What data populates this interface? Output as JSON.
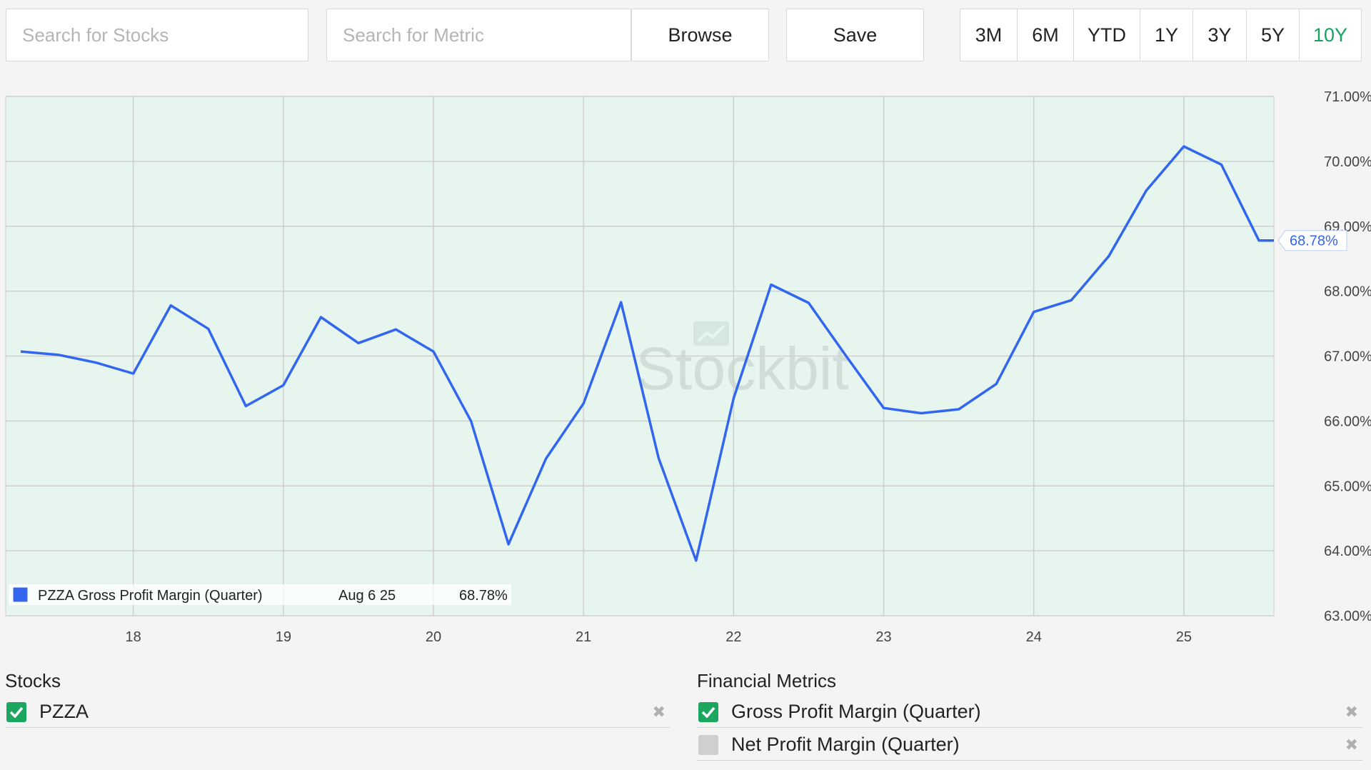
{
  "search": {
    "stocks_placeholder": "Search for Stocks",
    "metric_placeholder": "Search for Metric"
  },
  "toolbar": {
    "browse_label": "Browse",
    "save_label": "Save"
  },
  "ranges": [
    "3M",
    "6M",
    "YTD",
    "1Y",
    "3Y",
    "5Y",
    "10Y"
  ],
  "active_range": "10Y",
  "colors": {
    "series": "#3366ee",
    "plot_bg": "#e6f6ef",
    "active_range": "#16a35f",
    "checkbox_checked": "#1ca760",
    "checkbox_unchecked": "#cfcfcf"
  },
  "watermark": "Stockbit",
  "chart_data": {
    "type": "line",
    "title": "",
    "xlabel": "",
    "ylabel": "",
    "x_ticks": [
      "18",
      "19",
      "20",
      "21",
      "22",
      "23",
      "24",
      "25"
    ],
    "y_ticks": [
      "71.00%",
      "70.00%",
      "69.00%",
      "68.00%",
      "67.00%",
      "66.00%",
      "65.00%",
      "64.00%",
      "63.00%"
    ],
    "xlim": [
      2017.15,
      2025.6
    ],
    "ylim": [
      63,
      71
    ],
    "grid": true,
    "series": [
      {
        "name": "PZZA Gross Profit Margin (Quarter)",
        "x": [
          2017.25,
          2017.5,
          2017.75,
          2018.0,
          2018.25,
          2018.5,
          2018.75,
          2019.0,
          2019.25,
          2019.5,
          2019.75,
          2020.0,
          2020.25,
          2020.5,
          2020.75,
          2021.0,
          2021.25,
          2021.5,
          2021.75,
          2022.0,
          2022.25,
          2022.5,
          2022.75,
          2023.0,
          2023.25,
          2023.5,
          2023.75,
          2024.0,
          2024.25,
          2024.5,
          2024.75,
          2025.0,
          2025.25,
          2025.5,
          2025.6
        ],
        "y": [
          67.07,
          67.02,
          66.9,
          66.73,
          67.78,
          67.42,
          66.23,
          66.55,
          67.6,
          67.2,
          67.41,
          67.07,
          66.0,
          64.1,
          65.42,
          66.27,
          67.83,
          65.43,
          63.85,
          66.35,
          68.1,
          67.82,
          67.0,
          66.2,
          66.12,
          66.18,
          66.57,
          67.68,
          67.86,
          68.54,
          69.55,
          70.23,
          69.95,
          68.78,
          68.78
        ]
      }
    ],
    "last_value_label": "68.78%",
    "tooltip": {
      "series_name": "PZZA Gross Profit Margin (Quarter)",
      "date": "Aug 6 25",
      "value": "68.78%"
    }
  },
  "stocks": {
    "title": "Stocks",
    "items": [
      {
        "label": "PZZA",
        "checked": true
      }
    ]
  },
  "metrics": {
    "title": "Financial Metrics",
    "items": [
      {
        "label": "Gross Profit Margin (Quarter)",
        "checked": true
      },
      {
        "label": "Net Profit Margin (Quarter)",
        "checked": false
      }
    ]
  },
  "remove_glyph": "✖"
}
